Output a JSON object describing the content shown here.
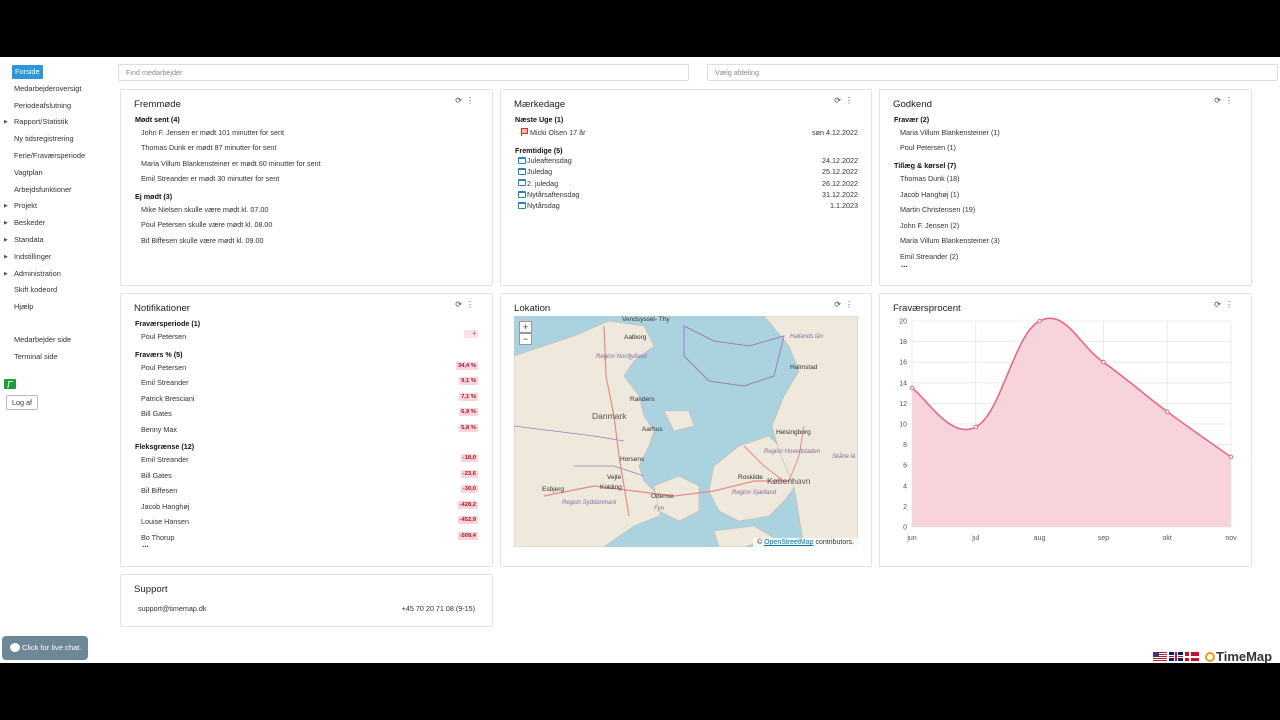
{
  "sidebar": {
    "items": [
      {
        "label": "Forside",
        "active": true,
        "caret": false
      },
      {
        "label": "Medarbejderoversigt",
        "caret": false
      },
      {
        "label": "Periodeafslutning",
        "caret": false
      },
      {
        "label": "Rapport/Statistik",
        "caret": true
      },
      {
        "label": "Ny tidsregistrering",
        "caret": false
      },
      {
        "label": "Ferie/Fraværsperiode",
        "caret": false
      },
      {
        "label": "Vagtplan",
        "caret": false
      },
      {
        "label": "Arbejdsfunktioner",
        "caret": false
      },
      {
        "label": "Projekt",
        "caret": true
      },
      {
        "label": "Beskeder",
        "caret": true
      },
      {
        "label": "Standata",
        "caret": true
      },
      {
        "label": "Indstillinger",
        "caret": true
      },
      {
        "label": "Administration",
        "caret": true
      },
      {
        "label": "Skift kodeord",
        "caret": false
      },
      {
        "label": "Hjælp",
        "caret": false
      }
    ],
    "secondary": [
      "Medarbejder side",
      "Terminal side"
    ],
    "logoff": "Log af"
  },
  "search": {
    "employee_placeholder": "Find medarbejder",
    "department_placeholder": "Vælg afdeling"
  },
  "fremmode": {
    "title": "Fremmøde",
    "late_header": "Mødt sent (4)",
    "late": [
      "John F. Jensen er mødt 101 minutter for sent",
      "Thomas Dunk er mødt 87 minutter for sent",
      "Maria Villum Blankensteiner er mødt 60 minutter for sent",
      "Emil Streander er mødt 30 minutter for sent"
    ],
    "absent_header": "Ej mødt (3)",
    "absent": [
      "Mike Nielsen skulle være mødt kl. 07.00",
      "Poul Petersen skulle være mødt kl. 08.00",
      "Bif Biffesen skulle være mødt kl. 09.00"
    ]
  },
  "maerkedage": {
    "title": "Mærkedage",
    "next_week_header": "Næste Uge (1)",
    "next_week": [
      {
        "name": "Micki Olsen 17 år",
        "date": "søn 4.12.2022"
      }
    ],
    "future_header": "Fremtidige (5)",
    "future": [
      {
        "name": "Juleaftensdag",
        "date": "24.12.2022"
      },
      {
        "name": "Juledag",
        "date": "25.12.2022"
      },
      {
        "name": "2. juledag",
        "date": "26.12.2022"
      },
      {
        "name": "Nytårsaftensdag",
        "date": "31.12.2022"
      },
      {
        "name": "Nytårsdag",
        "date": "1.1.2023"
      }
    ]
  },
  "godkend": {
    "title": "Godkend",
    "absence_header": "Fravær (2)",
    "absence": [
      "Maria Villum Blankensteiner (1)",
      "Poul Petersen (1)"
    ],
    "extras_header": "Tillæg & kørsel (7)",
    "extras": [
      "Thomas Dunk (18)",
      "Jacob Hanghøj (1)",
      "Martin Christensen (19)",
      "John F. Jensen (2)",
      "Maria Villum Blankensteiner (3)",
      "Emil Streander (2)"
    ],
    "more": "..."
  },
  "notifikationer": {
    "title": "Notifikationer",
    "period_header": "Fraværsperiode (1)",
    "period": [
      {
        "name": "Poul Petersen",
        "value": "+"
      }
    ],
    "pct_header": "Fraværs % (5)",
    "pct": [
      {
        "name": "Poul Petersen",
        "value": "34,4 %"
      },
      {
        "name": "Emil Streander",
        "value": "9,1 %"
      },
      {
        "name": "Patrick Bresciani",
        "value": "7,1 %"
      },
      {
        "name": "Bill Gates",
        "value": "6,9 %"
      },
      {
        "name": "Benny Max",
        "value": "5,8 %"
      }
    ],
    "flex_header": "Fleksgrænse (12)",
    "flex": [
      {
        "name": "Emil Streander",
        "value": "-18,0"
      },
      {
        "name": "Bill Gates",
        "value": "-23,6"
      },
      {
        "name": "Bif Biffesen",
        "value": "-30,0"
      },
      {
        "name": "Jacob Hanghøj",
        "value": "-428,2"
      },
      {
        "name": "Louise Hansen",
        "value": "-452,9"
      },
      {
        "name": "Bo Thorup",
        "value": "-509,4"
      }
    ],
    "more": "..."
  },
  "lokation": {
    "title": "Lokation",
    "zoom_in": "+",
    "zoom_out": "−",
    "attribution_prefix": "©",
    "attribution_link": "OpenStreetMap",
    "attribution_suffix": "contributors.",
    "labels": {
      "vendsyssel": "Vendsyssel-\nThy",
      "aalborg": "Aalborg",
      "nordjylland": "Region Nordjylland",
      "danmark": "Danmark",
      "randers": "Randers",
      "aarhus": "Aarhus",
      "horsens": "Horsens",
      "vejle": "Vejle",
      "kolding": "Kolding",
      "esbjerg": "Esbjerg",
      "odense": "Odense",
      "fyn": "Fyn",
      "syddanmark": "Region Syddanmark",
      "sjaelland": "Region Sjælland",
      "hovedstaden": "Region Hovedstaden",
      "roskilde": "Roskilde",
      "kobenhavn": "København",
      "helsingborg": "Helsingborg",
      "halmstad": "Halmstad",
      "skane": "Skåne lä",
      "hallands": "Hallands\nlän"
    }
  },
  "fravaersprocent": {
    "title": "Fraværsprocent"
  },
  "chart_data": {
    "type": "area",
    "categories": [
      "jun",
      "jul",
      "aug",
      "sep",
      "okt",
      "nov"
    ],
    "values": [
      13.5,
      9.7,
      20,
      16,
      11.2,
      6.8
    ],
    "ylim": [
      0,
      20
    ],
    "yticks": [
      0,
      2,
      4,
      6,
      8,
      10,
      12,
      14,
      16,
      18,
      20
    ],
    "line_color": "#e8678a",
    "fill_color": "#f7d3db",
    "grid": true
  },
  "support": {
    "title": "Support",
    "email": "support@timemap.dk",
    "phone": "+45 70 20 71 08 (9-15)"
  },
  "chat": {
    "label": "Click for live chat."
  },
  "brand": {
    "name": "TimeMap"
  },
  "colors": {
    "accent": "#2f96d8",
    "badge": "#f9d4da"
  }
}
